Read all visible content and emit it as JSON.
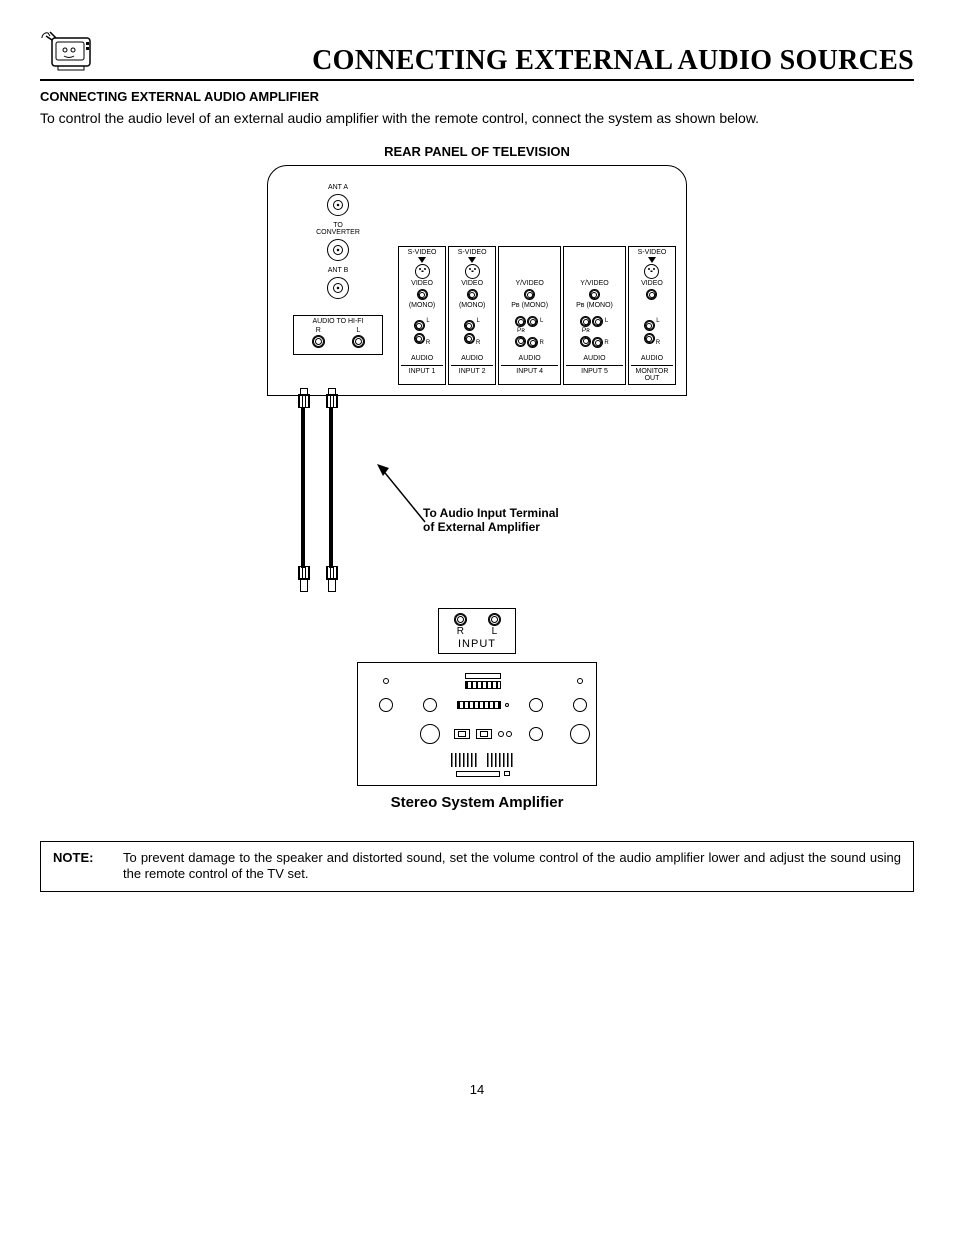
{
  "page": {
    "title": "CONNECTING EXTERNAL AUDIO SOURCES",
    "subhead": "CONNECTING EXTERNAL AUDIO AMPLIFIER",
    "intro": "To control the audio level of an external audio amplifier with the remote control, connect the system as shown below.",
    "panel_caption": "REAR PANEL OF TELEVISION",
    "page_number": "14"
  },
  "rear_panel": {
    "ant_a": "ANT A",
    "to_converter": "TO\nCONVERTER",
    "ant_b": "ANT B",
    "audio_to_hifi": "AUDIO TO HI-FI",
    "r": "R",
    "l": "L",
    "labels": {
      "svideo": "S-VIDEO",
      "video": "VIDEO",
      "yvideo": "Y/VIDEO",
      "mono": "(MONO)",
      "pb": "Pʙ",
      "pr": "Pʀ",
      "audio": "AUDIO",
      "l_side": "L",
      "r_side": "R"
    },
    "inputs": [
      "INPUT 1",
      "INPUT 2",
      "INPUT 4",
      "INPUT 5",
      "MONITOR\nOUT"
    ]
  },
  "callout": {
    "line1": "To Audio Input Terminal",
    "line2": "of External Amplifier"
  },
  "amp_input": {
    "r": "R",
    "l": "L",
    "label": "INPUT"
  },
  "amp_caption": "Stereo System Amplifier",
  "note": {
    "label": "NOTE:",
    "text": "To prevent damage to the speaker and distorted sound, set the volume control of the audio amplifier lower and adjust the sound using the remote control of the TV set."
  }
}
